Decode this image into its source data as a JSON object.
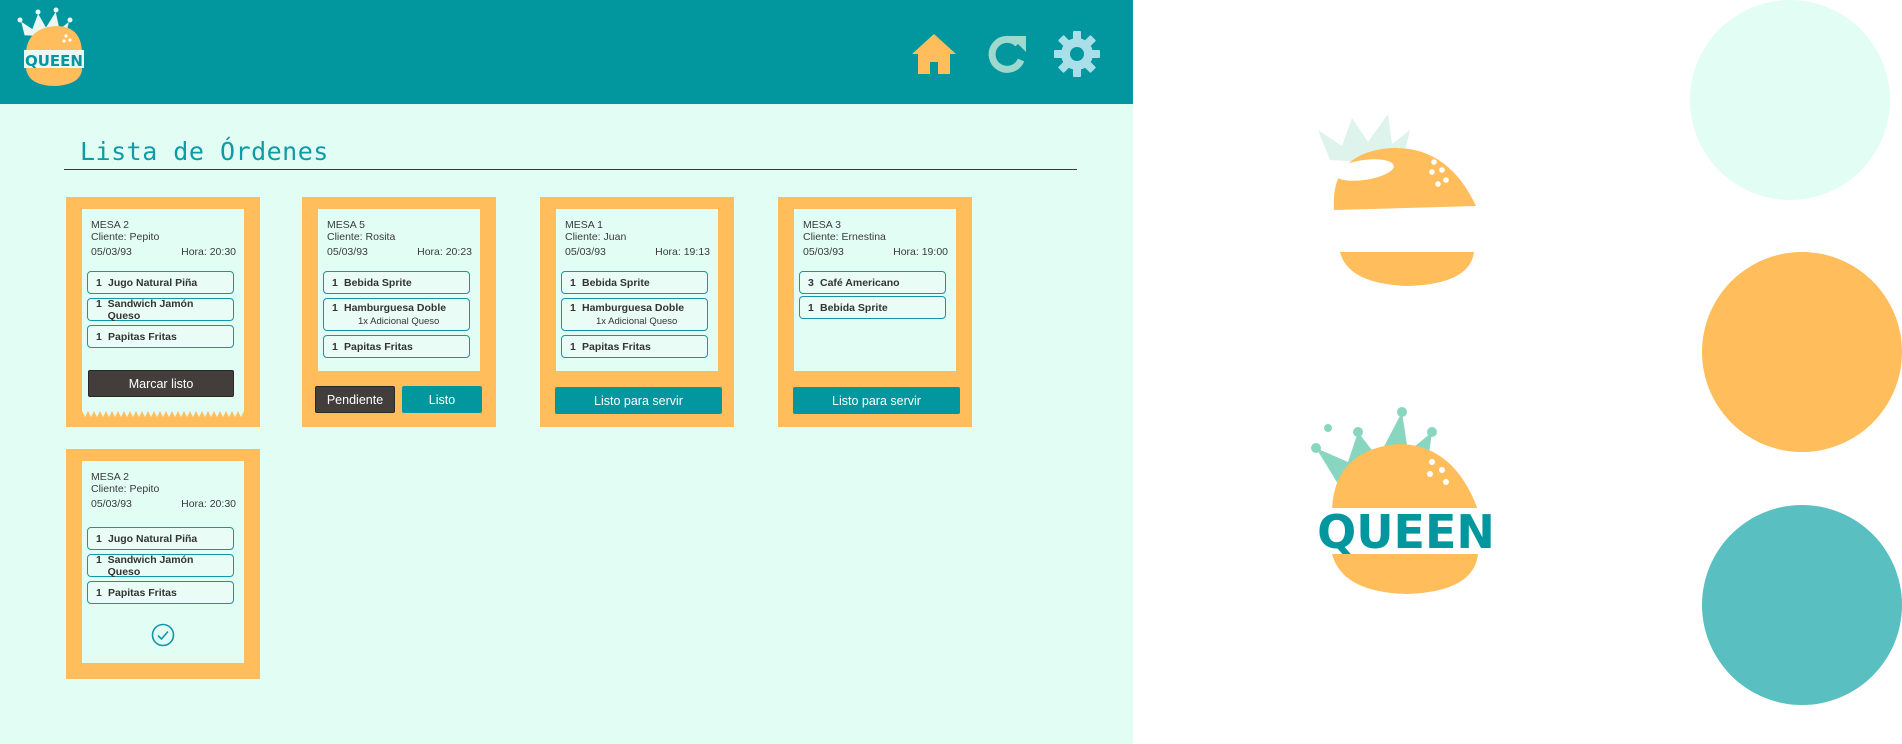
{
  "header": {
    "logo_text": "QUEEN",
    "nav": [
      {
        "icon": "home-icon",
        "color": "#ffbd5c"
      },
      {
        "icon": "refresh-icon",
        "color": "#9fd8cc"
      },
      {
        "icon": "gear-icon",
        "color": "#a9dfe8"
      }
    ]
  },
  "page": {
    "title": "Lista de Órdenes"
  },
  "orders": [
    {
      "table": "MESA 2",
      "client": "Cliente: Pepito",
      "date": "05/03/93",
      "time": "Hora: 20:30",
      "items": [
        {
          "qty": "1",
          "name": "Jugo Natural Piña"
        },
        {
          "qty": "1",
          "name": "Sandwich Jamón Queso"
        },
        {
          "qty": "1",
          "name": "Papitas Fritas"
        }
      ],
      "action": "Marcar listo"
    },
    {
      "table": "MESA 5",
      "client": "Cliente: Rosita",
      "date": "05/03/93",
      "time": "Hora: 20:23",
      "items": [
        {
          "qty": "1",
          "name": "Bebida Sprite"
        },
        {
          "qty": "1",
          "name": "Hamburguesa Doble",
          "extra": "1x Adicional Queso"
        },
        {
          "qty": "1",
          "name": "Papitas Fritas"
        }
      ],
      "actions": [
        "Pendiente",
        "Listo"
      ]
    },
    {
      "table": "MESA 1",
      "client": "Cliente: Juan",
      "date": "05/03/93",
      "time": "Hora: 19:13",
      "items": [
        {
          "qty": "1",
          "name": "Bebida Sprite"
        },
        {
          "qty": "1",
          "name": "Hamburguesa Doble",
          "extra": "1x Adicional Queso"
        },
        {
          "qty": "1",
          "name": "Papitas Fritas"
        }
      ],
      "action": "Listo para servir"
    },
    {
      "table": "MESA 3",
      "client": "Cliente: Ernestina",
      "date": "05/03/93",
      "time": "Hora: 19:00",
      "items": [
        {
          "qty": "3",
          "name": "Café Americano"
        },
        {
          "qty": "1",
          "name": "Bebida Sprite"
        }
      ],
      "action": "Listo para servir"
    },
    {
      "table": "MESA 2",
      "client": "Cliente: Pepito",
      "date": "05/03/93",
      "time": "Hora: 20:30",
      "items": [
        {
          "qty": "1",
          "name": "Jugo Natural Piña"
        },
        {
          "qty": "1",
          "name": "Sandwich Jamón Queso"
        },
        {
          "qty": "1",
          "name": "Papitas Fritas"
        }
      ],
      "status_icon": "check-circle-icon"
    }
  ],
  "brand": {
    "logo_text": "QUEEN",
    "swatches": [
      "#e2fdf4",
      "#ffbd5c",
      "#59bfc0"
    ]
  },
  "colors": {
    "teal": "#02969f",
    "orange": "#ffbd5c",
    "mint": "#e2fdf4",
    "dark": "#433d3c"
  }
}
